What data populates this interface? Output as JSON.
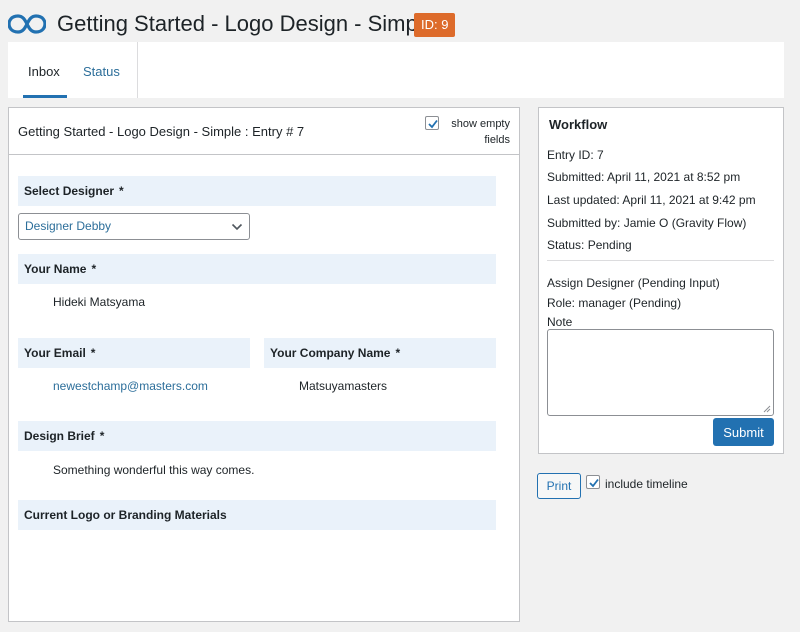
{
  "header": {
    "title": "Getting Started - Logo Design - Simple",
    "id_badge": "ID: 9",
    "logo_icon": "gravity-flow-infinity-icon",
    "badge_color": "#dd6b2b"
  },
  "tabs": [
    {
      "label": "Inbox",
      "active": true
    },
    {
      "label": "Status",
      "active": false
    }
  ],
  "entry": {
    "title": "Getting Started - Logo Design - Simple : Entry # 7",
    "show_empty_fields_label": "show empty fields",
    "show_empty_fields_checked": true,
    "required_marker": "*",
    "fields": {
      "select_designer": {
        "label": "Select Designer",
        "value": "Designer Debby"
      },
      "your_name": {
        "label": "Your Name",
        "value": "Hideki Matsyama"
      },
      "your_email": {
        "label": "Your Email",
        "value": "newestchamp@masters.com"
      },
      "company_name": {
        "label": "Your Company Name",
        "value": "Matsuyamasters"
      },
      "design_brief": {
        "label": "Design Brief",
        "value": "Something wonderful this way comes."
      },
      "current_logo": {
        "label": "Current Logo or Branding Materials"
      }
    }
  },
  "workflow": {
    "title": "Workflow",
    "entry_id": "Entry ID: 7",
    "submitted": "Submitted: April 11, 2021 at 8:52 pm",
    "last_updated": "Last updated: April 11, 2021 at 9:42 pm",
    "submitted_by": "Submitted by: Jamie O (Gravity Flow)",
    "status": "Status: Pending",
    "step": "Assign Designer (Pending Input)",
    "role": "Role: manager (Pending)",
    "note_label": "Note",
    "note_value": "",
    "submit_label": "Submit"
  },
  "footer": {
    "print_label": "Print",
    "include_timeline_label": "include timeline",
    "include_timeline_checked": true
  },
  "colors": {
    "accent": "#2271b1",
    "label_bg": "#eaf2fa",
    "link": "#2c6e9a"
  }
}
